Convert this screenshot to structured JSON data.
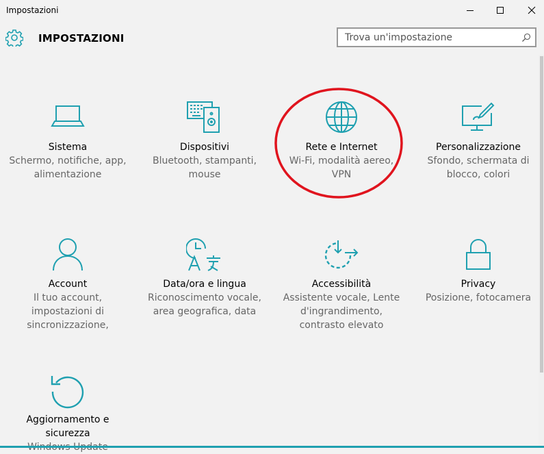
{
  "window": {
    "title": "Impostazioni",
    "controls": {
      "minimize": "minimize-icon",
      "maximize": "maximize-icon",
      "close": "close-icon"
    }
  },
  "header": {
    "icon": "gear-icon",
    "title": "IMPOSTAZIONI",
    "search_placeholder": "Trova un'impostazione"
  },
  "colors": {
    "accent": "#1fa0b0",
    "annotation": "#e0141e",
    "description": "#666666"
  },
  "tiles": [
    {
      "icon": "laptop-icon",
      "title": "Sistema",
      "desc": [
        "Schermo, notifiche, app,",
        "alimentazione"
      ]
    },
    {
      "icon": "devices-icon",
      "title": "Dispositivi",
      "desc": [
        "Bluetooth, stampanti,",
        "mouse"
      ]
    },
    {
      "icon": "globe-icon",
      "title": "Rete e Internet",
      "desc": [
        "Wi-Fi, modalità aereo,",
        "VPN"
      ]
    },
    {
      "icon": "personalize-icon",
      "title": "Personalizzazione",
      "desc": [
        "Sfondo, schermata di",
        "blocco, colori"
      ]
    },
    {
      "icon": "person-icon",
      "title": "Account",
      "desc": [
        "Il tuo account,",
        "impostazioni di",
        "sincronizzazione,"
      ]
    },
    {
      "icon": "time-language-icon",
      "title": "Data/ora e lingua",
      "desc": [
        "Riconoscimento vocale,",
        "area geografica, data"
      ]
    },
    {
      "icon": "accessibility-icon",
      "title": "Accessibilità",
      "desc": [
        "Assistente vocale, Lente",
        "d'ingrandimento,",
        "contrasto elevato"
      ]
    },
    {
      "icon": "lock-icon",
      "title": "Privacy",
      "desc": [
        "Posizione, fotocamera"
      ]
    },
    {
      "icon": "update-icon",
      "title": "Aggiornamento e sicurezza",
      "title_lines": [
        "Aggiornamento e",
        "sicurezza"
      ],
      "desc": [
        "Windows Update"
      ]
    }
  ]
}
